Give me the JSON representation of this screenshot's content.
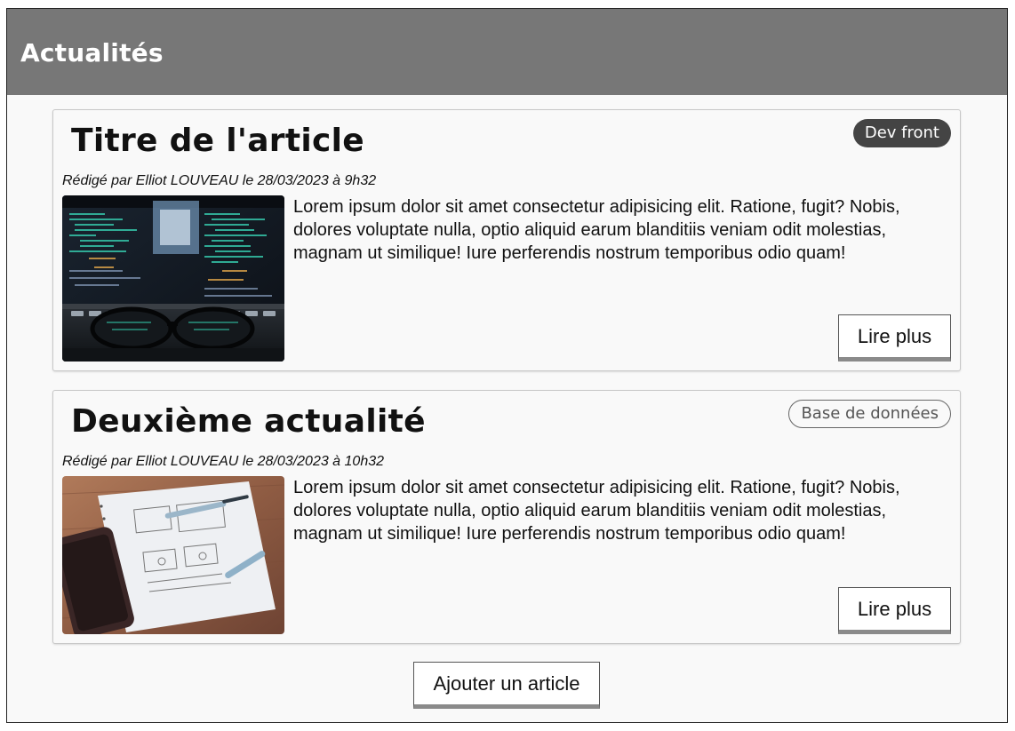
{
  "header": {
    "title": "Actualités",
    "background": "#777777"
  },
  "articles": [
    {
      "title": "Titre de l'article",
      "meta": "Rédigé par Elliot LOUVEAU le 28/03/2023 à 9h32",
      "tag": "Dev front",
      "tag_style": "dark",
      "body": "Lorem ipsum dolor sit amet consectetur adipisicing elit. Ratione, fugit? Nobis, dolores voluptate nulla, optio aliquid earum blanditiis veniam odit molestias, magnam ut similique! Iure perferendis nostrum temporibus odio quam!",
      "read_more": "Lire plus",
      "image": "code-screen-glasses-photo"
    },
    {
      "title": "Deuxième actualité",
      "meta": "Rédigé par Elliot LOUVEAU le 28/03/2023 à 10h32",
      "tag": "Base de données",
      "tag_style": "outline",
      "body": "Lorem ipsum dolor sit amet consectetur adipisicing elit. Ratione, fugit? Nobis, dolores voluptate nulla, optio aliquid earum blanditiis veniam odit molestias, magnam ut similique! Iure perferendis nostrum temporibus odio quam!",
      "read_more": "Lire plus",
      "image": "wireframe-notebook-phone-photo"
    }
  ],
  "add_button": "Ajouter un article",
  "colors": {
    "tag_dark": "#444444",
    "button_underline": "#8a8a8a",
    "page_background": "#f9f9f9"
  }
}
